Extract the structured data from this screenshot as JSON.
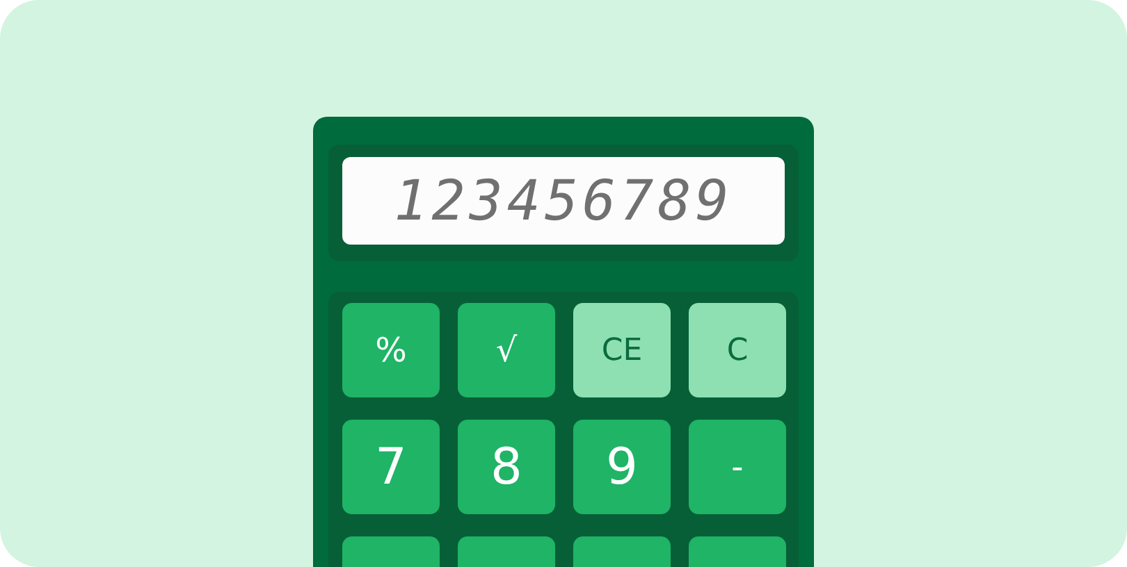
{
  "display": {
    "value": "123456789"
  },
  "keys": [
    {
      "label": "%",
      "kind": "function"
    },
    {
      "label": "√",
      "kind": "function"
    },
    {
      "label": "CE",
      "kind": "clear"
    },
    {
      "label": "C",
      "kind": "clear"
    },
    {
      "label": "7",
      "kind": "digit"
    },
    {
      "label": "8",
      "kind": "digit"
    },
    {
      "label": "9",
      "kind": "digit"
    },
    {
      "label": "-",
      "kind": "function"
    },
    {
      "kind": "digit"
    },
    {
      "kind": "digit"
    },
    {
      "kind": "digit"
    },
    {
      "kind": "function"
    }
  ]
}
